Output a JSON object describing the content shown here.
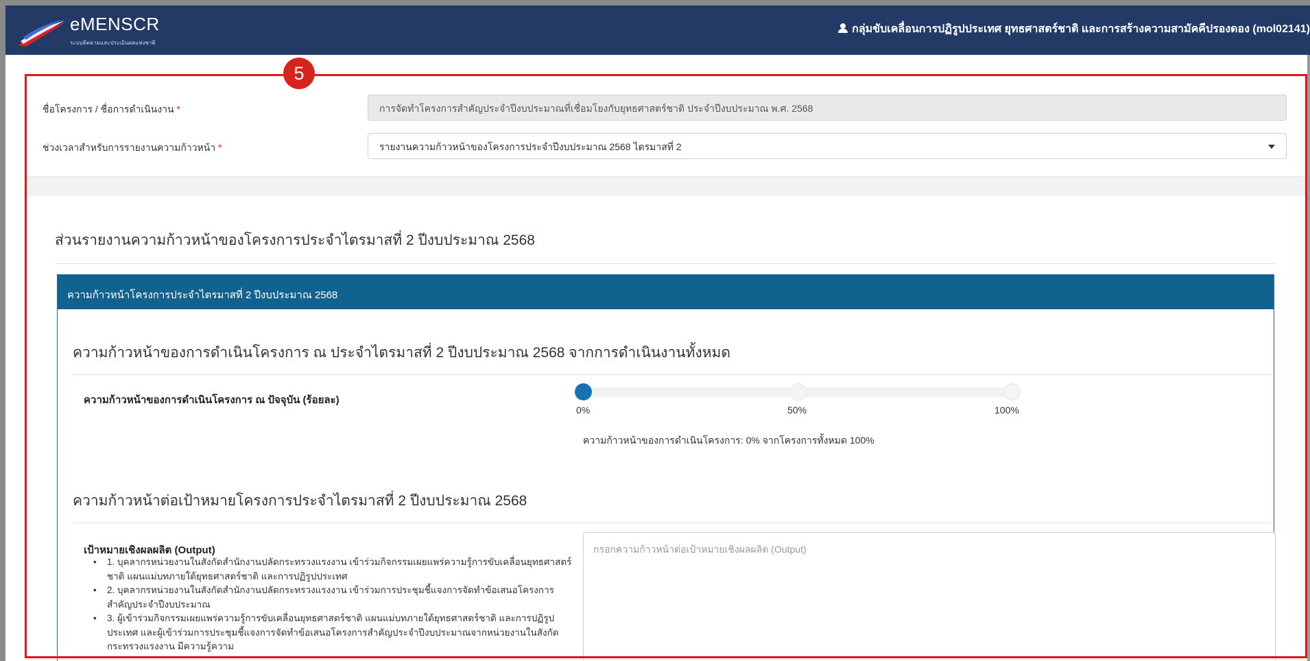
{
  "header": {
    "app_name": "eMENSCR",
    "app_subtitle": "ระบบติดตามและประเมินผลแห่งชาติ",
    "user_label": "กลุ่มขับเคลื่อนการปฏิรูปประเทศ ยุทธศาสตร์ชาติ และการสร้างความสามัคคีปรองดอง (mol02141)"
  },
  "annotation": {
    "step_number": "5",
    "color": "#e8121b"
  },
  "form": {
    "project_name_label": "ชื่อโครงการ / ชื่อการดำเนินงาน",
    "project_name_value": "การจัดทำโครงการสำคัญประจำปีงบประมาณที่เชื่อมโยงกับยุทธศาสตร์ชาติ ประจำปีงบประมาณ พ.ศ. 2568",
    "period_label": "ช่วงเวลาสำหรับการรายงานความก้าวหน้า",
    "period_value": "รายงานความก้าวหน้าของโครงการประจำปีงบประมาณ 2568 ไตรมาสที่ 2",
    "required_mark": "*"
  },
  "report": {
    "section_title": "ส่วนรายงานความก้าวหน้าของโครงการประจำไตรมาสที่ 2 ปีงบประมาณ 2568",
    "card_title": "ความก้าวหน้าโครงการประจำไตรมาสที่ 2 ปีงบประมาณ 2568",
    "overall_heading": "ความก้าวหน้าของการดำเนินโครงการ ณ ประจำไตรมาสที่ 2 ปีงบประมาณ 2568 จากการดำเนินงานทั้งหมด",
    "progress_label": "ความก้าวหน้าของการดำเนินโครงการ ณ ปัจจุบัน (ร้อยละ)",
    "progress_value": 0,
    "slider_ticks": [
      "0%",
      "50%",
      "100%"
    ],
    "progress_summary": "ความก้าวหน้าของการดำเนินโครงการ: 0% จากโครงการทั้งหมด 100%",
    "target_heading": "ความก้าวหน้าต่อเป้าหมายโครงการประจำไตรมาสที่ 2 ปีงบประมาณ 2568",
    "output_title": "เป้าหมายเชิงผลผลิต (Output)",
    "output_items": [
      "1. บุคลากรหน่วยงานในสังกัดสำนักงานปลัดกระทรวงแรงงาน เข้าร่วมกิจกรรมเผยแพร่ความรู้การขับเคลื่อนยุทธศาสตร์ชาติ แผนแม่บทภายใต้ยุทธศาสตร์ชาติ และการปฏิรูปประเทศ",
      "2. บุคลากรหน่วยงานในสังกัดสำนักงานปลัดกระทรวงแรงงาน เข้าร่วมการประชุมชี้แจงการจัดทำข้อเสนอโครงการสำคัญประจำปีงบประมาณ",
      "3. ผู้เข้าร่วมกิจกรรมเผยแพร่ความรู้การขับเคลื่อนยุทธศาสตร์ชาติ แผนแม่บทภายใต้ยุทธศาสตร์ชาติ และการปฏิรูปประเทศ และผู้เข้าร่วมการประชุมชี้แจงการจัดทำข้อเสนอโครงการสำคัญประจำปีงบประมาณจากหน่วยงานในสังกัดกระทรวงแรงงาน มีความรู้ความ"
    ],
    "output_placeholder": "กรอกความก้าวหน้าต่อเป้าหมายเชิงผลผลิต (Output)"
  }
}
